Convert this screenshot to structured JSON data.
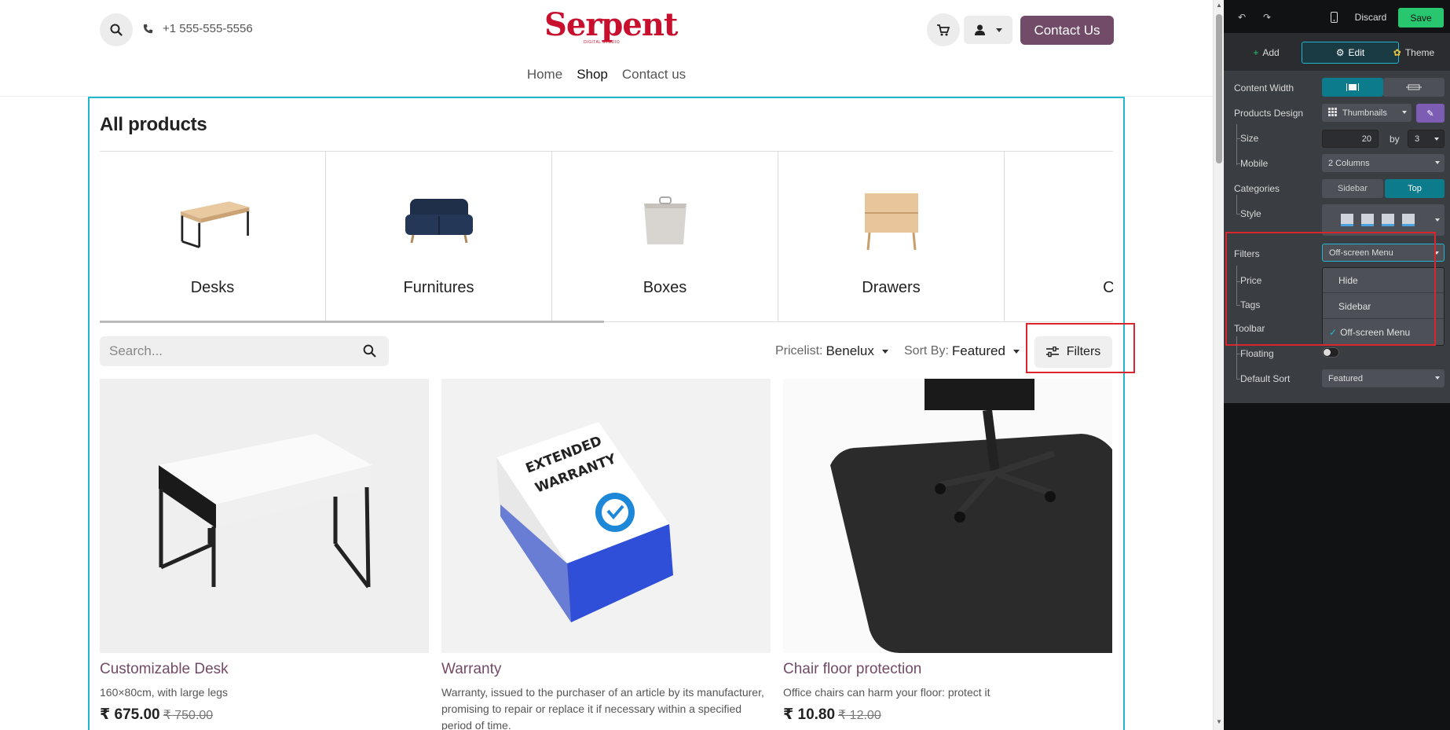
{
  "header": {
    "phone": "+1 555-555-5556",
    "logo_text": "Serpent",
    "logo_sub": "DIGITAL STUDIO",
    "contact_button": "Contact Us",
    "nav": [
      "Home",
      "Shop",
      "Contact us"
    ],
    "nav_active": "Shop"
  },
  "shop": {
    "title": "All products",
    "categories": [
      "Desks",
      "Furnitures",
      "Boxes",
      "Drawers",
      "Cab"
    ],
    "search_placeholder": "Search...",
    "pricelist_label": "Pricelist:",
    "pricelist_value": "Benelux",
    "sort_label": "Sort By:",
    "sort_value": "Featured",
    "filters_button": "Filters",
    "products": [
      {
        "name": "Customizable Desk",
        "desc": "160×80cm, with large legs",
        "price": "₹ 675.00",
        "old_price": "₹ 750.00"
      },
      {
        "name": "Warranty",
        "desc": "Warranty, issued to the purchaser of an article by its manufacturer, promising to repair or replace it if necessary within a specified period of time.",
        "price": "",
        "old_price": ""
      },
      {
        "name": "Chair floor protection",
        "desc": "Office chairs can harm your floor: protect it",
        "price": "₹ 10.80",
        "old_price": "₹ 12.00"
      }
    ],
    "warranty_box_text_1": "EXTENDED",
    "warranty_box_text_2": "WARRANTY"
  },
  "panel": {
    "discard": "Discard",
    "save": "Save",
    "tabs": [
      "Add",
      "Edit",
      "Theme"
    ],
    "active_tab": "Edit",
    "rows": {
      "content_width": "Content Width",
      "products_design": "Products Design",
      "products_design_value": "Thumbnails",
      "size": "Size",
      "size_value": "20",
      "by": "by",
      "size_cols": "3",
      "mobile": "Mobile",
      "mobile_value": "2 Columns",
      "categories": "Categories",
      "categories_sidebar": "Sidebar",
      "categories_top": "Top",
      "style": "Style",
      "filters": "Filters",
      "filters_value": "Off-screen Menu",
      "price": "Price",
      "tags": "Tags",
      "toolbar": "Toolbar",
      "floating": "Floating",
      "default_sort": "Default Sort",
      "default_sort_value": "Featured"
    },
    "filters_options": [
      "Hide",
      "Sidebar",
      "Off-screen Menu"
    ],
    "filters_selected": "Off-screen Menu",
    "accent_color": "#20b6cf",
    "save_color": "#28c76f"
  }
}
